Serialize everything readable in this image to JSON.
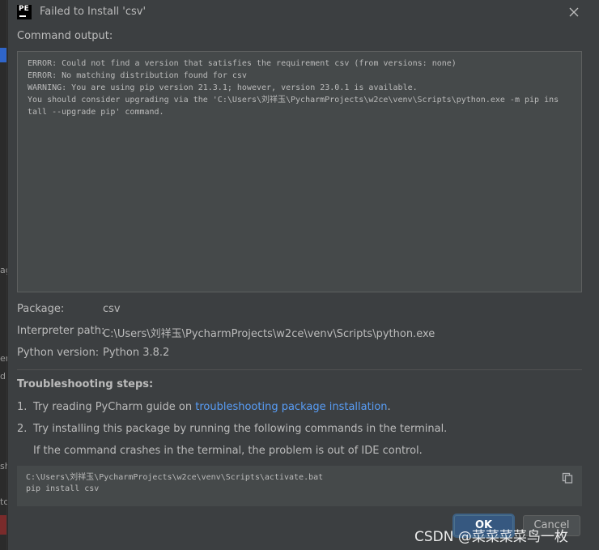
{
  "background_ide": {
    "fragments": [
      "ag",
      "er",
      "d",
      "sh",
      "to",
      "d"
    ]
  },
  "dialog": {
    "app_icon_text": "PE",
    "title": "Failed to Install 'csv'",
    "command_output_label": "Command output:",
    "command_output": "ERROR: Could not find a version that satisfies the requirement csv (from versions: none)\nERROR: No matching distribution found for csv\nWARNING: You are using pip version 21.3.1; however, version 23.0.1 is available.\nYou should consider upgrading via the 'C:\\Users\\刘祥玉\\PycharmProjects\\w2ce\\venv\\Scripts\\python.exe -m pip ins\ntall --upgrade pip' command.",
    "info": [
      {
        "label": "Package:",
        "value": "csv"
      },
      {
        "label": "Interpreter path:",
        "value": "C:\\Users\\刘祥玉\\PycharmProjects\\w2ce\\venv\\Scripts\\python.exe"
      },
      {
        "label": "Python version:",
        "value": "Python 3.8.2"
      }
    ],
    "troubleshooting": {
      "title": "Troubleshooting steps:",
      "step1_num": "1.",
      "step1_prefix": "Try reading PyCharm guide on ",
      "step1_link": "troubleshooting package installation",
      "step1_suffix": ".",
      "step2_num": "2.",
      "step2_text": "Try installing this package by running the following commands in the terminal.",
      "step2_note": "If the command crashes in the terminal, the problem is out of IDE control."
    },
    "commands": [
      "C:\\Users\\刘祥玉\\PycharmProjects\\w2ce\\venv\\Scripts\\activate.bat",
      "pip install csv"
    ],
    "buttons": {
      "ok": "OK",
      "cancel": "Cancel"
    },
    "watermark": "CSDN @菜菜菜菜鸟一枚"
  },
  "colors": {
    "dialog_bg": "#3c3f41",
    "link": "#589df6",
    "ok_button": "#365880"
  }
}
